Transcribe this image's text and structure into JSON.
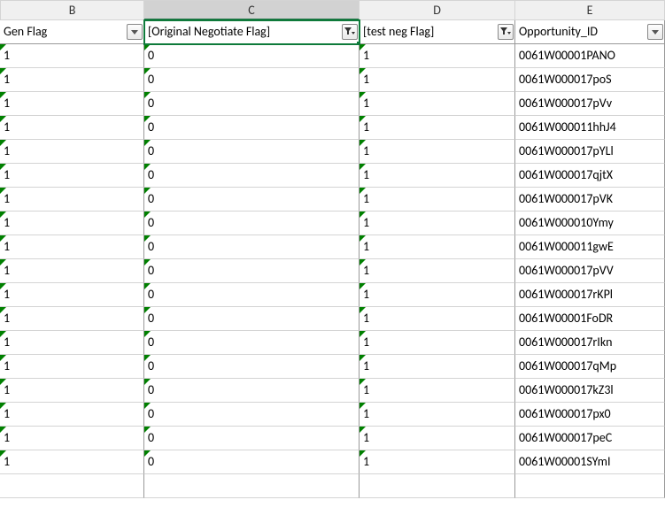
{
  "columns": {
    "letters": [
      "B",
      "C",
      "D",
      "E"
    ],
    "active": "C",
    "headers": [
      {
        "label": "Gen Flag",
        "filtered": false
      },
      {
        "label": "[Original Negotiate Flag]",
        "filtered": true,
        "selected": true
      },
      {
        "label": "[test neg Flag]",
        "filtered": true
      },
      {
        "label": "Opportunity_ID",
        "filtered": false
      }
    ]
  },
  "rows": [
    {
      "b": "1",
      "c": "0",
      "d": "1",
      "e": "0061W00001PANO"
    },
    {
      "b": "1",
      "c": "0",
      "d": "1",
      "e": "0061W000017poS"
    },
    {
      "b": "1",
      "c": "0",
      "d": "1",
      "e": "0061W000017pVv"
    },
    {
      "b": "1",
      "c": "0",
      "d": "1",
      "e": "0061W000011hhJ4"
    },
    {
      "b": "1",
      "c": "0",
      "d": "1",
      "e": "0061W000017pYLl"
    },
    {
      "b": "1",
      "c": "0",
      "d": "1",
      "e": "0061W000017qjtX"
    },
    {
      "b": "1",
      "c": "0",
      "d": "1",
      "e": "0061W000017pVK"
    },
    {
      "b": "1",
      "c": "0",
      "d": "1",
      "e": "0061W000010Ymy"
    },
    {
      "b": "1",
      "c": "0",
      "d": "1",
      "e": "0061W000011gwE"
    },
    {
      "b": "1",
      "c": "0",
      "d": "1",
      "e": "0061W000017pVV"
    },
    {
      "b": "1",
      "c": "0",
      "d": "1",
      "e": "0061W000017rKPl"
    },
    {
      "b": "1",
      "c": "0",
      "d": "1",
      "e": "0061W00001FoDR"
    },
    {
      "b": "1",
      "c": "0",
      "d": "1",
      "e": "0061W000017rIkn"
    },
    {
      "b": "1",
      "c": "0",
      "d": "1",
      "e": "0061W000017qMp"
    },
    {
      "b": "1",
      "c": "0",
      "d": "1",
      "e": "0061W000017kZ3l"
    },
    {
      "b": "1",
      "c": "0",
      "d": "1",
      "e": "0061W000017px0"
    },
    {
      "b": "1",
      "c": "0",
      "d": "1",
      "e": "0061W000017peC"
    },
    {
      "b": "1",
      "c": "0",
      "d": "1",
      "e": "0061W00001SYmI"
    }
  ],
  "end_row": {
    "b": "",
    "c": "",
    "d": "",
    "e": ""
  }
}
